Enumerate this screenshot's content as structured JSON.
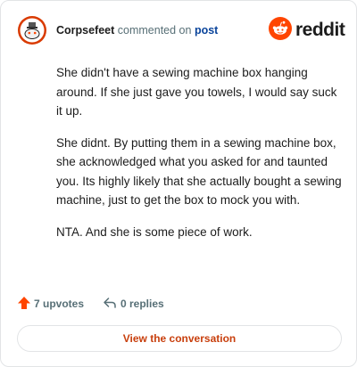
{
  "header": {
    "username": "Corpsefeet",
    "action_text": " commented on ",
    "post_link": "post",
    "brand": "reddit"
  },
  "comment": {
    "paragraphs": [
      "She didn't have a sewing machine box hanging around. If she just gave you towels, I would say suck it up.",
      "She didnt. By putting them in a sewing machine box, she acknowledged what you asked for and taunted you. Its highly likely that she actually bought a sewing machine, just to get the box to mock you with.",
      "NTA. And she is some piece of work."
    ]
  },
  "footer": {
    "upvotes": "7 upvotes",
    "replies": "0 replies"
  },
  "cta": {
    "label": "View the conversation"
  },
  "colors": {
    "brand": "#ff4500",
    "link": "#0a449b",
    "cta_text": "#c83f0d",
    "upvote": "#ff4500"
  }
}
